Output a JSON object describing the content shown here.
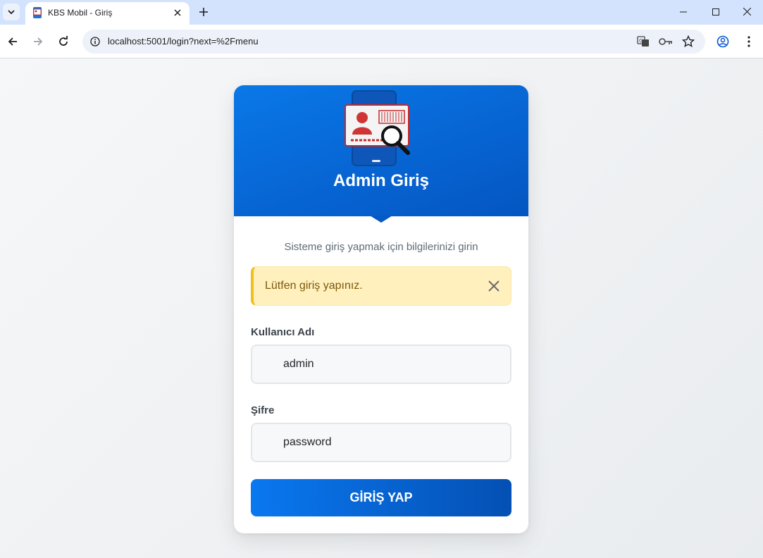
{
  "browser": {
    "tab_title": "KBS Mobil - Giriş",
    "url": "localhost:5001/login?next=%2Fmenu"
  },
  "login": {
    "title": "Admin Giriş",
    "subtitle": "Sisteme giriş yapmak için bilgilerinizi girin",
    "alert": "Lütfen giriş yapınız.",
    "username_label": "Kullanıcı Adı",
    "username_value": "admin",
    "password_label": "Şifre",
    "password_value": "password",
    "submit_label": "GİRİŞ YAP"
  },
  "colors": {
    "header_blue": "#0a6ede",
    "alert_bg": "#fff0be",
    "alert_border": "#f0c018",
    "button_blue": "#0a78f0"
  }
}
